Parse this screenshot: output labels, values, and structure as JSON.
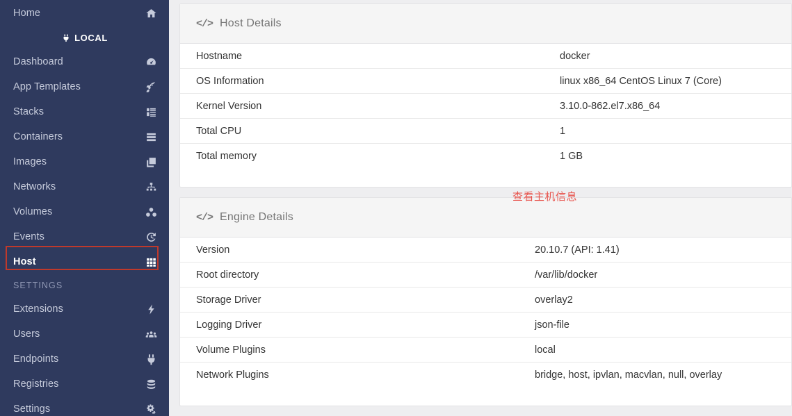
{
  "sidebar": {
    "home": {
      "label": "Home",
      "icon": "home-icon"
    },
    "endpoint": {
      "label": "LOCAL",
      "icon": "plug-icon"
    },
    "items": [
      {
        "label": "Dashboard",
        "icon": "dashboard-icon",
        "active": false
      },
      {
        "label": "App Templates",
        "icon": "rocket-icon",
        "active": false
      },
      {
        "label": "Stacks",
        "icon": "stacks-icon",
        "active": false
      },
      {
        "label": "Containers",
        "icon": "containers-icon",
        "active": false
      },
      {
        "label": "Images",
        "icon": "images-icon",
        "active": false
      },
      {
        "label": "Networks",
        "icon": "networks-icon",
        "active": false
      },
      {
        "label": "Volumes",
        "icon": "volumes-icon",
        "active": false
      },
      {
        "label": "Events",
        "icon": "history-icon",
        "active": false
      },
      {
        "label": "Host",
        "icon": "grid-icon",
        "active": true
      }
    ],
    "settings_section_label": "SETTINGS",
    "settings_items": [
      {
        "label": "Extensions",
        "icon": "bolt-icon"
      },
      {
        "label": "Users",
        "icon": "users-icon"
      },
      {
        "label": "Endpoints",
        "icon": "plug-icon"
      },
      {
        "label": "Registries",
        "icon": "database-icon"
      },
      {
        "label": "Settings",
        "icon": "gears-icon"
      }
    ]
  },
  "annotation": {
    "text": "查看主机信息",
    "color": "#e8554e"
  },
  "panels": [
    {
      "id": "host-details",
      "icon": "code-icon",
      "title": "Host Details",
      "rows": [
        {
          "key": "Hostname",
          "value": "docker"
        },
        {
          "key": "OS Information",
          "value": "linux x86_64 CentOS Linux 7 (Core)"
        },
        {
          "key": "Kernel Version",
          "value": "3.10.0-862.el7.x86_64"
        },
        {
          "key": "Total CPU",
          "value": "1"
        },
        {
          "key": "Total memory",
          "value": "1 GB"
        }
      ]
    },
    {
      "id": "engine-details",
      "icon": "code-icon",
      "title": "Engine Details",
      "rows": [
        {
          "key": "Version",
          "value": "20.10.7 (API: 1.41)"
        },
        {
          "key": "Root directory",
          "value": "/var/lib/docker"
        },
        {
          "key": "Storage Driver",
          "value": "overlay2"
        },
        {
          "key": "Logging Driver",
          "value": "json-file"
        },
        {
          "key": "Volume Plugins",
          "value": "local"
        },
        {
          "key": "Network Plugins",
          "value": "bridge, host, ipvlan, macvlan, null, overlay"
        }
      ]
    }
  ],
  "theme": {
    "sidebar_bg": "#2f3a5e",
    "body_bg": "#eeeef0",
    "panel_head_bg": "#f5f5f5",
    "highlight_border": "#c0392b"
  }
}
